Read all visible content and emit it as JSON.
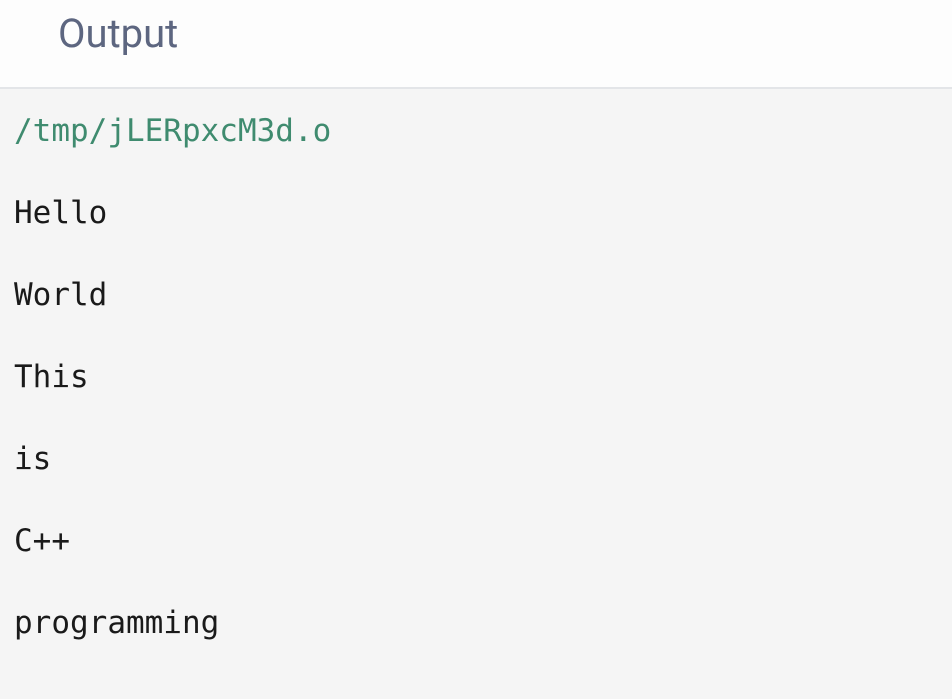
{
  "header": {
    "title": "Output"
  },
  "output": {
    "file_path": "/tmp/jLERpxcM3d.o",
    "lines": [
      "Hello",
      "World",
      "This",
      "is",
      "C++",
      "programming"
    ]
  }
}
